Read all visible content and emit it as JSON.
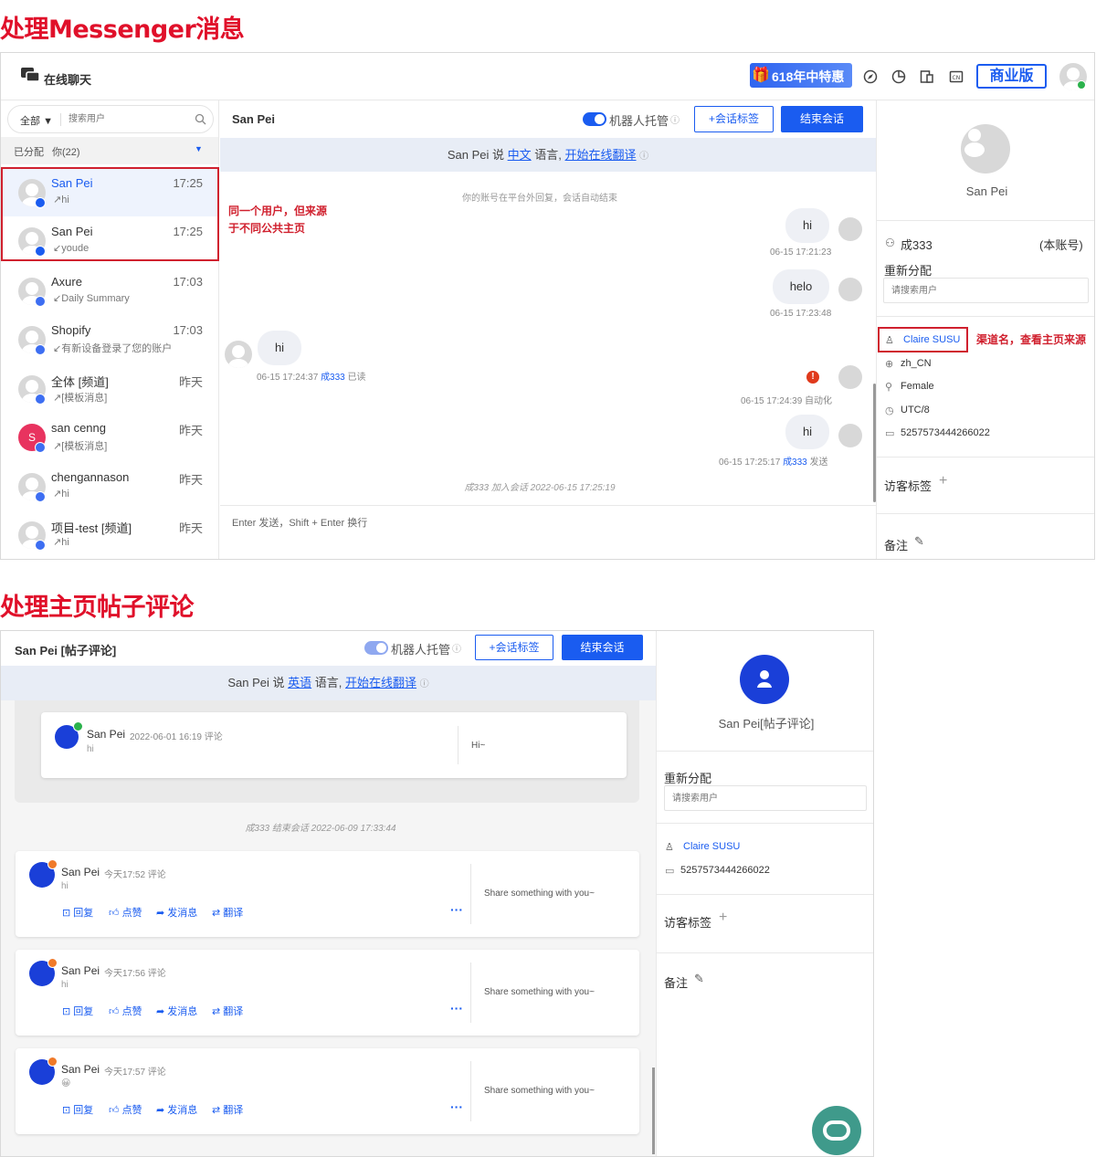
{
  "section1_heading": "处理Messenger消息",
  "section2_heading": "处理主页帖子评论",
  "top": {
    "app_title": "在线聊天",
    "promo": "618年中特惠",
    "edition": "商业版"
  },
  "sidebar": {
    "filter": "全部",
    "search_placeholder": "搜索用户",
    "assigned": "已分配",
    "mine": "你(22)",
    "conversations": [
      {
        "name": "San Pei",
        "time": "17:25",
        "preview": "hi"
      },
      {
        "name": "San Pei",
        "time": "17:25",
        "preview": "youde"
      },
      {
        "name": "Axure",
        "time": "17:03",
        "preview": "Daily Summary"
      },
      {
        "name": "Shopify",
        "time": "17:03",
        "preview": "有新设备登录了您的账户"
      },
      {
        "name": "全体 [频道]",
        "time": "昨天",
        "preview": "[模板消息]"
      },
      {
        "name": "san cenng",
        "time": "昨天",
        "preview": "[模板消息]"
      },
      {
        "name": "chengannason",
        "time": "昨天",
        "preview": "hi"
      },
      {
        "name": "项目-test [频道]",
        "time": "昨天",
        "preview": "hi"
      }
    ]
  },
  "annotation1": "同一个用户，但来源于不同公共主页",
  "annotation2": "渠道名，查看主页来源",
  "chat1": {
    "title": "San Pei",
    "robot": "机器人托管",
    "tag_btn": "+会话标签",
    "end_btn": "结束会话",
    "lang_pre": "San Pei 说",
    "lang": "中文",
    "lang_mid": "语言,",
    "translate": "开始在线翻译",
    "system1": "你的账号在平台外回复，会话自动结束",
    "m1": "hi",
    "m1t": "06-15 17:21:23",
    "m2": "helo",
    "m2t": "06-15 17:23:48",
    "m3": "hi",
    "m3t": "06-15 17:24:37",
    "m3a": "成333",
    "m3s": "已读",
    "m4t": "06-15 17:24:39 自动化",
    "m5": "hi",
    "m5t": "06-15 17:25:17",
    "m5a": "成333",
    "m5s": "发送",
    "system2": "成333 加入会话 2022-06-15 17:25:19",
    "input_hint": "Enter 发送，Shift + Enter 换行"
  },
  "right1": {
    "name": "San Pei",
    "agent": "成333",
    "self": "(本账号)",
    "reassign": "重新分配",
    "search_placeholder": "请搜索用户",
    "channel": "Claire SUSU",
    "locale": "zh_CN",
    "gender": "Female",
    "tz": "UTC/8",
    "id": "5257573444266022",
    "tags": "访客标签",
    "note": "备注"
  },
  "chat2": {
    "title": "San Pei [帖子评论]",
    "robot": "机器人托管",
    "tag_btn": "+会话标签",
    "end_btn": "结束会话",
    "lang_pre": "San Pei 说",
    "lang": "英语",
    "lang_mid": "语言,",
    "translate": "开始在线翻译",
    "old": {
      "name": "San Pei",
      "meta": "2022-06-01 16:19 评论",
      "text": "hi",
      "post": "Hi~"
    },
    "system": "成333 结束会话 2022-06-09 17:33:44",
    "comments": [
      {
        "name": "San Pei",
        "meta": "今天17:52 评论",
        "text": "hi",
        "post": "Share something with you~"
      },
      {
        "name": "San Pei",
        "meta": "今天17:56 评论",
        "text": "hi",
        "post": "Share something with you~"
      },
      {
        "name": "San Pei",
        "meta": "今天17:57 评论",
        "text": "😀",
        "post": "Share something with you~"
      }
    ],
    "actions": {
      "reply": "回复",
      "like": "点赞",
      "msg": "发消息",
      "trans": "翻译"
    }
  },
  "right2": {
    "name": "San Pei[帖子评论]",
    "reassign": "重新分配",
    "search_placeholder": "请搜索用户",
    "channel": "Claire SUSU",
    "id": "5257573444266022",
    "tags": "访客标签",
    "note": "备注"
  }
}
